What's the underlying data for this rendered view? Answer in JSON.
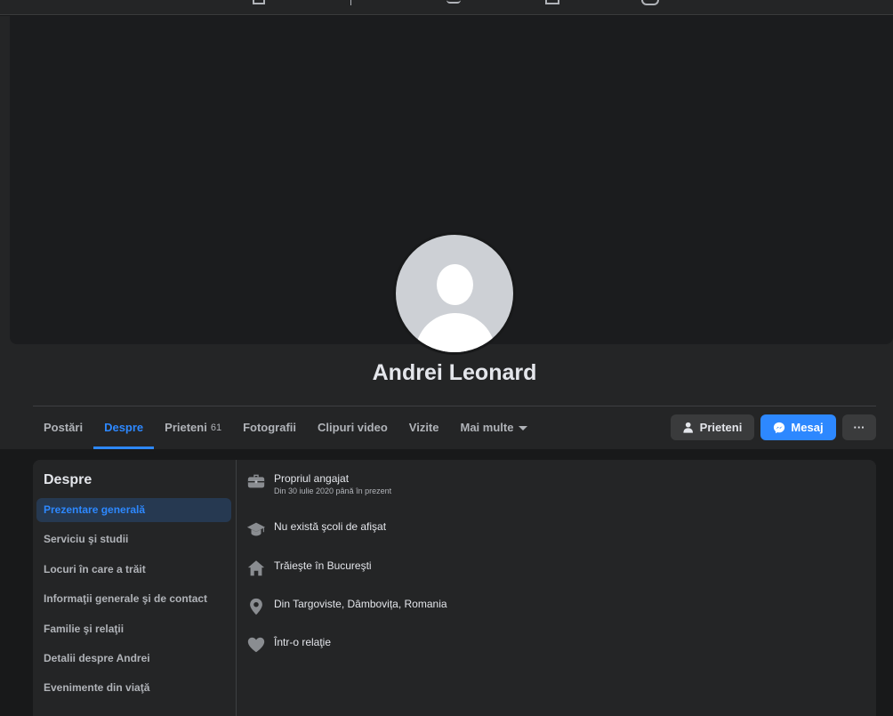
{
  "profile": {
    "name": "Andrei Leonard"
  },
  "tabs": [
    {
      "label": "Postări"
    },
    {
      "label": "Despre"
    },
    {
      "label": "Prieteni",
      "count": "61"
    },
    {
      "label": "Fotografii"
    },
    {
      "label": "Clipuri video"
    },
    {
      "label": "Vizite"
    },
    {
      "label": "Mai multe"
    }
  ],
  "actions": {
    "friends_label": "Prieteni",
    "message_label": "Mesaj",
    "more_label": "···"
  },
  "about": {
    "title": "Despre",
    "sidebar": [
      {
        "label": "Prezentare generală"
      },
      {
        "label": "Serviciu şi studii"
      },
      {
        "label": "Locuri în care a trăit"
      },
      {
        "label": "Informaţii generale şi de contact"
      },
      {
        "label": "Familie şi relaţii"
      },
      {
        "label": "Detalii despre Andrei"
      },
      {
        "label": "Evenimente din viaţă"
      }
    ],
    "overview": [
      {
        "icon": "briefcase-icon",
        "text": "Propriul angajat",
        "sub": "Din 30 iulie 2020 până în prezent"
      },
      {
        "icon": "graduation-cap-icon",
        "text": "Nu există şcoli de afişat"
      },
      {
        "icon": "home-icon",
        "text": "Trăieşte în Bucureşti"
      },
      {
        "icon": "location-pin-icon",
        "text": "Din Targoviste, Dâmbovița, Romania"
      },
      {
        "icon": "heart-icon",
        "text": "Într-o relaţie"
      }
    ]
  },
  "colors": {
    "accent": "#2d88ff",
    "background": "#18191a",
    "surface": "#242526",
    "button": "#3a3b3c"
  }
}
